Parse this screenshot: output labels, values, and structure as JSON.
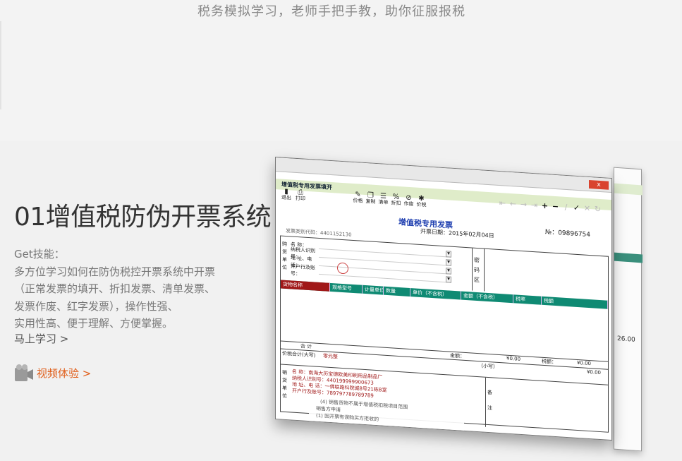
{
  "header": {
    "slogan": "税务模拟学习，老师手把手教，助你征服报税"
  },
  "feature": {
    "title": "01增值税防伪开票系统",
    "skills_label": "Get技能：",
    "skills_lines": [
      "多方位学习如何在防伪税控开票系统中开票",
      "（正常发票的填开、折扣发票、清单发票、",
      "发票作废、红字发票），操作性强、",
      "实用性高、便于理解、方便掌握。"
    ],
    "learn_link": "马上学习 >",
    "video_label": "视频体验 >",
    "video_icon": "film-reel-icon",
    "link_color": "#e05e1a"
  },
  "screenshot": {
    "window_title": "增值税专用发票填开",
    "close_label": "x",
    "left_tools": [
      {
        "icon": "exit-icon",
        "label": "退出"
      },
      {
        "icon": "print-icon",
        "label": "打印"
      }
    ],
    "center_tools": [
      {
        "icon": "pen-icon",
        "label": "价格"
      },
      {
        "icon": "copy-icon",
        "label": "复制"
      },
      {
        "icon": "list-icon",
        "label": "清单"
      },
      {
        "icon": "discount-icon",
        "label": "折扣"
      },
      {
        "icon": "void-icon",
        "label": "作废"
      },
      {
        "icon": "tax-icon",
        "label": "价税"
      }
    ],
    "invoice_title": "增值税专用发票",
    "invoice_date": "开票日期：2015年02月04日",
    "invoice_no": "№：09896754",
    "invoice_code": "发票类别代码：4401152130",
    "buyer_side": "购货单位",
    "buyer_rows": [
      "名    称：",
      "纳税人识别号：",
      "地 址、电 话：",
      "开户行及账号："
    ],
    "password_label": "密码区",
    "columns": [
      "货物名称",
      "规格型号",
      "计量单位",
      "数量",
      "单价（不含税）",
      "金额（不含税）",
      "税率",
      "税额"
    ],
    "total_label": "合    计",
    "total_amount": "¥0.00",
    "total_tax": "¥0.00",
    "tax_label": "税额：",
    "amount_label": "金额：",
    "grand_label": "价税合计(大写)",
    "grand_value": "零元整",
    "small_label": "（小写）",
    "grand_small": "¥0.00",
    "seller_side": "销货单位",
    "seller_rows": [
      "名    称：南海大历宝德欧美印刷用品制品厂",
      "纳税人识别号：440199999900673",
      "地 址、电 话：一佛联路科院城8号21栋B室",
      "开户行及账号：789797789789789"
    ],
    "note_label": "备注",
    "popup_lines": [
      "销售方申请",
      "(1) 因开票有误购买方拒收的",
      "(4) 销售货物不属于增值税扣税项目范围"
    ],
    "back_window_value": "26.00"
  }
}
